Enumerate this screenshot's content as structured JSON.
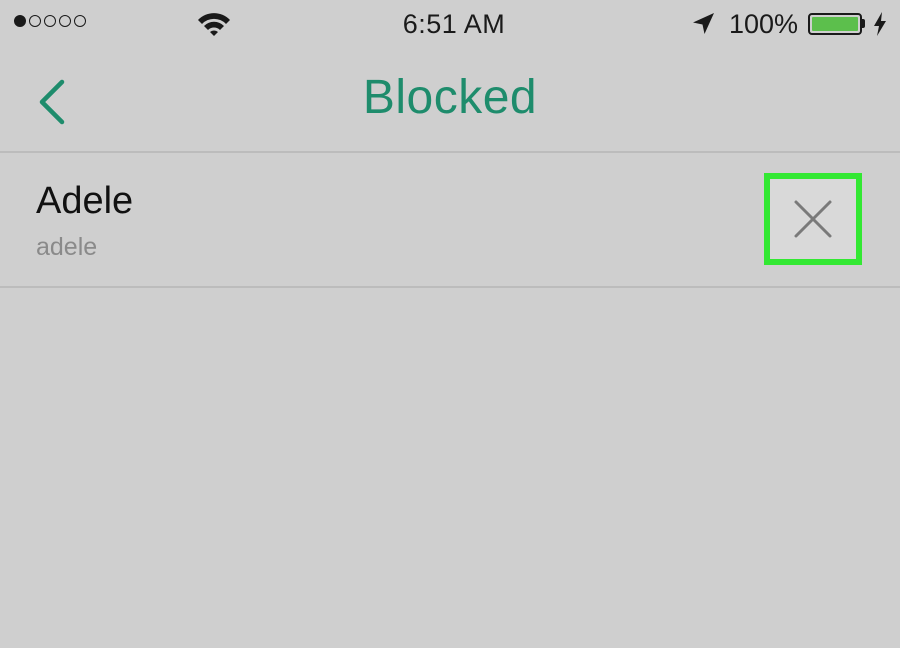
{
  "status_bar": {
    "signal_bars_filled": 1,
    "signal_bars_total": 5,
    "time": "6:51 AM",
    "battery_percent": "100%",
    "battery_level": 1.0,
    "icons": [
      "signal-dots",
      "wifi-icon",
      "location-arrow-icon",
      "battery-icon",
      "charging-bolt-icon"
    ]
  },
  "nav": {
    "back_icon": "chevron-left-icon",
    "title": "Blocked"
  },
  "blocked_list": [
    {
      "name": "Adele",
      "username": "adele",
      "action_icon": "close-icon"
    }
  ],
  "colors": {
    "background": "#cfcfcf",
    "accent_teal": "#1e8c6c",
    "highlight_green": "#33e833",
    "battery_green": "#5cbf4c",
    "secondary_text": "#8a8a8a"
  }
}
